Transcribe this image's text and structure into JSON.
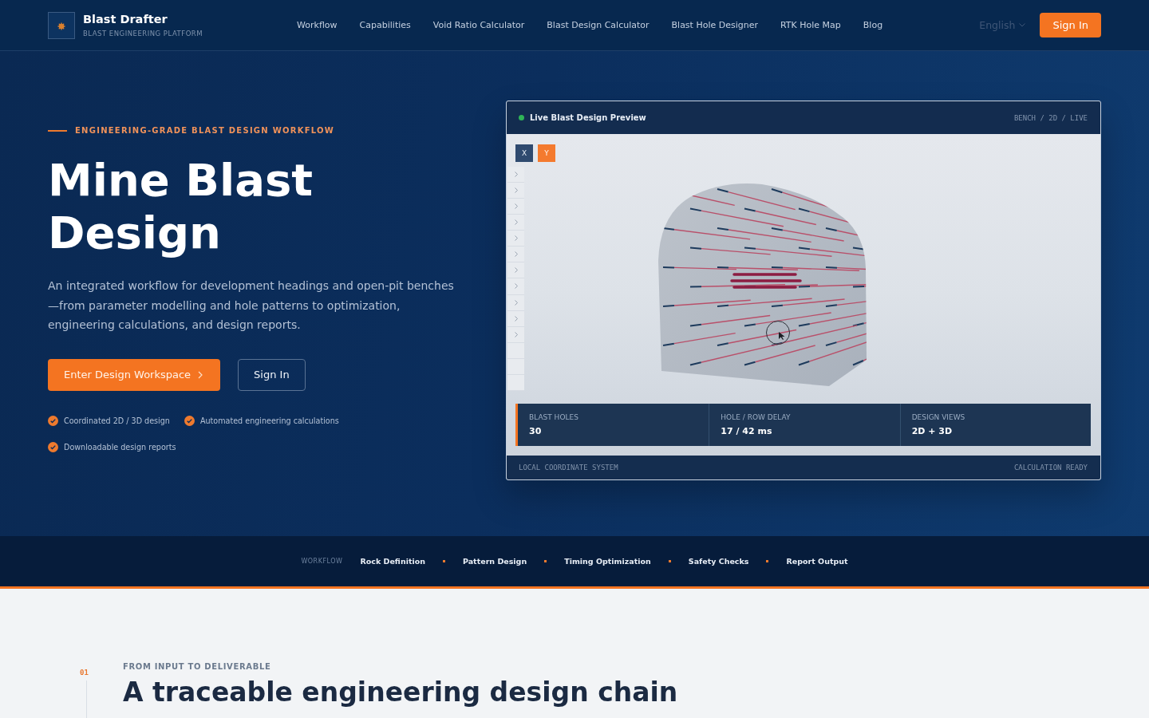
{
  "header": {
    "brand": {
      "name": "Blast Drafter",
      "tagline": "BLAST ENGINEERING PLATFORM"
    },
    "nav": [
      "Workflow",
      "Capabilities",
      "Void Ratio Calculator",
      "Blast Design Calculator",
      "Blast Hole Designer",
      "RTK Hole Map",
      "Blog"
    ],
    "language": "English",
    "sign_in": "Sign In"
  },
  "hero": {
    "eyebrow": "ENGINEERING-GRADE BLAST DESIGN WORKFLOW",
    "title": "Mine Blast Design",
    "description": "An integrated workflow for development headings and open-pit benches—from parameter modelling and hole patterns to optimization, engineering calculations, and design reports.",
    "primary_action": "Enter Design Workspace",
    "secondary_action": "Sign In",
    "features": [
      "Coordinated 2D / 3D design",
      "Automated engineering calculations",
      "Downloadable design reports"
    ]
  },
  "preview": {
    "title": "Live Blast Design Preview",
    "mode": "BENCH / 2D / LIVE",
    "axes": [
      {
        "label": "X",
        "selected": false
      },
      {
        "label": "Y",
        "selected": true
      }
    ],
    "stats": [
      {
        "label": "BLAST HOLES",
        "value": "30"
      },
      {
        "label": "HOLE / ROW DELAY",
        "value": "17 / 42 ms"
      },
      {
        "label": "DESIGN VIEWS",
        "value": "2D + 3D"
      }
    ],
    "footer_left": "LOCAL COORDINATE SYSTEM",
    "footer_right": "CALCULATION READY"
  },
  "workflow_bar": {
    "label": "WORKFLOW",
    "steps": [
      "Rock Definition",
      "Pattern Design",
      "Timing Optimization",
      "Safety Checks",
      "Report Output"
    ]
  },
  "section": {
    "number": "01",
    "eyebrow": "FROM INPUT TO DELIVERABLE",
    "title": "A traceable engineering design chain"
  }
}
